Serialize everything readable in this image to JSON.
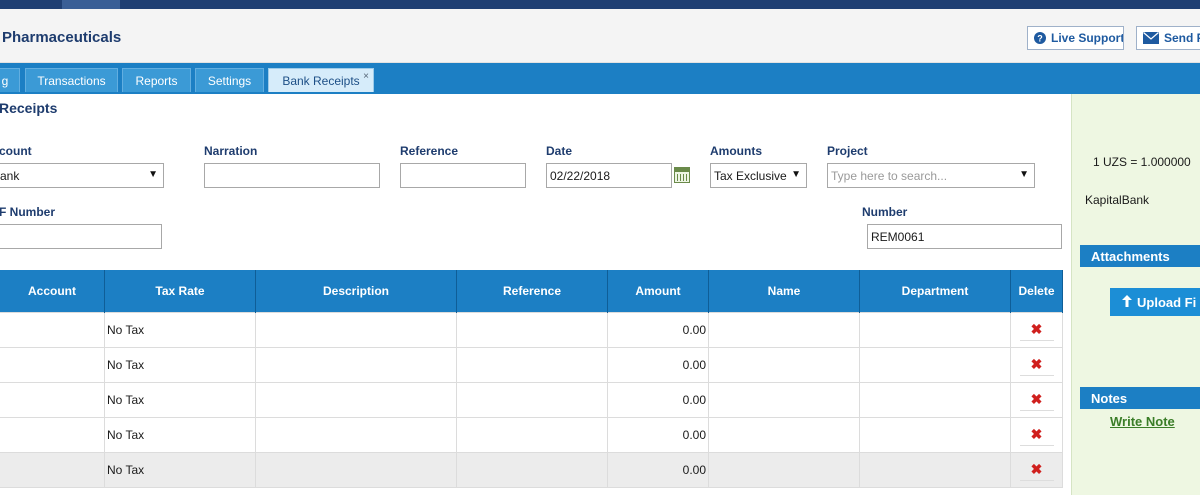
{
  "header": {
    "company": "Pharmaceuticals",
    "live_support": "Live Support",
    "send": "Send F"
  },
  "tabs": [
    {
      "label": "g"
    },
    {
      "label": "Transactions"
    },
    {
      "label": "Reports"
    },
    {
      "label": "Settings"
    },
    {
      "label": "Bank Receipts",
      "close": "×"
    }
  ],
  "form": {
    "title": "Receipts",
    "account_label": "count",
    "account_value": "ank",
    "narration_label": "Narration",
    "narration_value": "",
    "reference_label": "Reference",
    "reference_value": "",
    "date_label": "Date",
    "date_value": "02/22/2018",
    "amounts_label": "Amounts",
    "amounts_value": "Tax Exclusive",
    "project_label": "Project",
    "project_placeholder": "Type here to search...",
    "ref_number_label": "F Number",
    "ref_number_value": "",
    "number_label": "Number",
    "number_value": "REM0061"
  },
  "table": {
    "headers": [
      "Account",
      "Tax Rate",
      "Description",
      "Reference",
      "Amount",
      "Name",
      "Department",
      "Delete"
    ],
    "rows": [
      {
        "account": "",
        "tax_rate": "No Tax",
        "description": "",
        "reference": "",
        "amount": "0.00",
        "name": "",
        "department": ""
      },
      {
        "account": "",
        "tax_rate": "No Tax",
        "description": "",
        "reference": "",
        "amount": "0.00",
        "name": "",
        "department": ""
      },
      {
        "account": "",
        "tax_rate": "No Tax",
        "description": "",
        "reference": "",
        "amount": "0.00",
        "name": "",
        "department": ""
      },
      {
        "account": "",
        "tax_rate": "No Tax",
        "description": "",
        "reference": "",
        "amount": "0.00",
        "name": "",
        "department": ""
      },
      {
        "account": "",
        "tax_rate": "No Tax",
        "description": "",
        "reference": "",
        "amount": "0.00",
        "name": "",
        "department": ""
      }
    ],
    "delete_glyph": "✖"
  },
  "sidebar": {
    "rate": "1  UZS =   1.000000",
    "bank": "KapitalBank",
    "attachments": "Attachments",
    "upload": "Upload Fi",
    "notes": "Notes",
    "write_note": "Write Note"
  },
  "colors": {
    "nav": "#1f3f73",
    "tab_bar": "#1c7fc4",
    "sidebar_bg": "#eef7e2",
    "delete": "#d0201e"
  }
}
